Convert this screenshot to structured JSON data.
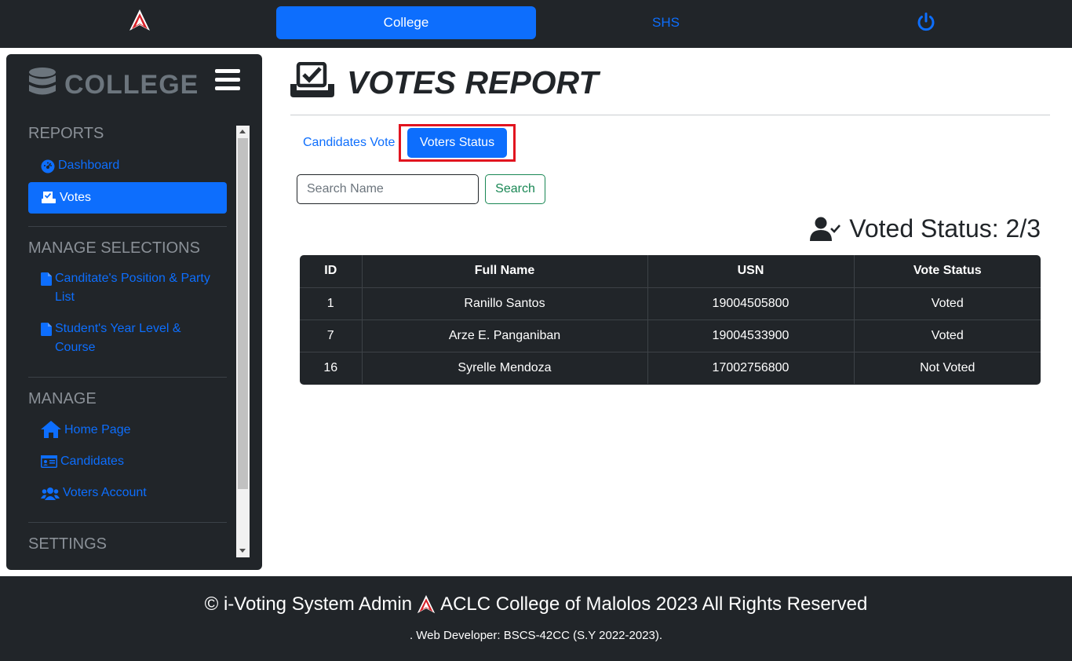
{
  "topbar": {
    "tabs": [
      "College",
      "SHS"
    ],
    "icons": [
      "aclc-logo-icon",
      "power-icon"
    ]
  },
  "sidebar": {
    "title": "COLLEGE",
    "sections": {
      "reports": "REPORTS",
      "manage_selections": "MANAGE SELECTIONS",
      "manage": "MANAGE",
      "settings": "SETTINGS"
    },
    "items": {
      "dashboard": "Dashboard",
      "votes": "Votes",
      "position_party": "Canditate's Position & Party List",
      "year_course": "Student's Year Level & Course",
      "home_page": "Home Page",
      "candidates": "Candidates",
      "voters_account": "Voters Account"
    }
  },
  "main": {
    "title": "VOTES REPORT",
    "tabs": {
      "candidates_vote": "Candidates Vote",
      "voters_status": "Voters Status"
    },
    "search": {
      "placeholder": "Search Name",
      "value": "",
      "button": "Search"
    },
    "voted_status": "Voted Status: 2/3",
    "table": {
      "headers": [
        "ID",
        "Full Name",
        "USN",
        "Vote Status"
      ],
      "rows": [
        [
          "1",
          "Ranillo Santos",
          "19004505800",
          "Voted"
        ],
        [
          "7",
          "Arze E. Panganiban",
          "19004533900",
          "Voted"
        ],
        [
          "16",
          "Syrelle Mendoza",
          "17002756800",
          "Not Voted"
        ]
      ]
    }
  },
  "footer": {
    "line1_left": "© i-Voting System Admin",
    "line1_right": "ACLC College of Malolos 2023 All Rights Reserved",
    "line2": ". Web Developer: BSCS-42CC (S.Y 2022-2023)."
  },
  "colors": {
    "primary": "#0d6efd",
    "dark": "#212529",
    "success": "#198754",
    "highlight": "#e1141f"
  }
}
